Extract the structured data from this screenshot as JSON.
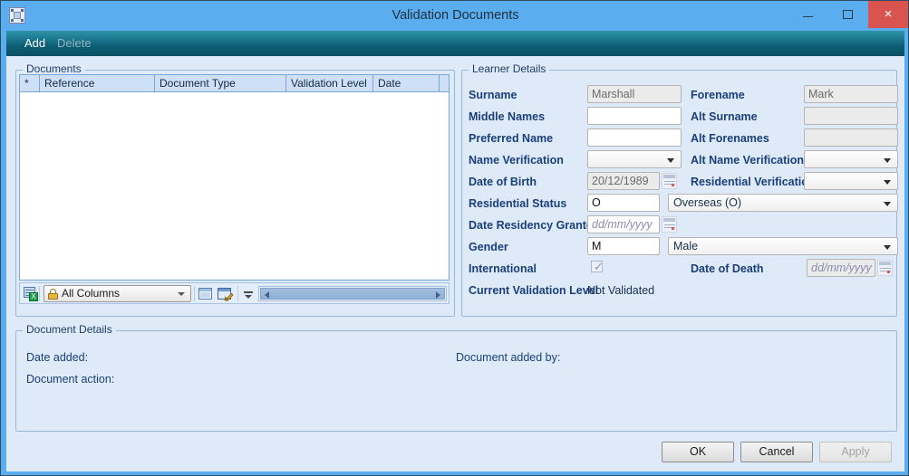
{
  "window": {
    "title": "Validation Documents",
    "app_icon": "grid-app-icon",
    "minimize": "minimize-icon",
    "maximize": "maximize-icon",
    "close_glyph": "×"
  },
  "actionbar": {
    "add": "Add",
    "delete": "Delete"
  },
  "documents": {
    "legend": "Documents",
    "columns": [
      {
        "label": "*"
      },
      {
        "label": "Reference"
      },
      {
        "label": "Document Type"
      },
      {
        "label": "Validation Level"
      },
      {
        "label": "Date"
      },
      {
        "label": ""
      }
    ],
    "rows": [],
    "toolbar": {
      "export_icon": "export-to-excel-icon",
      "export_mark": "X",
      "column_filter": {
        "lock_icon": "lock-icon",
        "value": "All Columns"
      },
      "layout_icon": "grid-layout-icon",
      "edit_layout_icon": "edit-grid-layout-icon",
      "splitter_icon": "splitter-handle-icon",
      "scroll_left_icon": "scroll-left-arrow-icon",
      "scroll_right_icon": "scroll-right-arrow-icon"
    }
  },
  "learner": {
    "legend": "Learner Details",
    "left": {
      "surname_label": "Surname",
      "surname_value": "Marshall",
      "middle_names_label": "Middle Names",
      "middle_names_value": "",
      "preferred_name_label": "Preferred Name",
      "preferred_name_value": "",
      "name_verification_label": "Name Verification",
      "name_verification_value": "",
      "dob_label": "Date of Birth",
      "dob_value": "20/12/1989",
      "residential_status_label": "Residential Status",
      "residential_status_code": "O",
      "residential_status_value": "Overseas (O)",
      "date_residency_label": "Date Residency Granted",
      "date_residency_placeholder": "dd/mm/yyyy",
      "gender_label": "Gender",
      "gender_code": "M",
      "gender_value": "Male",
      "international_label": "International",
      "international_checked": "✓",
      "current_validation_label": "Current Validation Level",
      "current_validation_value": "Not Validated"
    },
    "right": {
      "forename_label": "Forename",
      "forename_value": "Mark",
      "alt_surname_label": "Alt Surname",
      "alt_surname_value": "",
      "alt_forenames_label": "Alt Forenames",
      "alt_forenames_value": "",
      "alt_name_verification_label": "Alt Name Verification",
      "alt_name_verification_value": "",
      "residential_verification_label": "Residential Verification",
      "residential_verification_value": "",
      "date_of_death_label": "Date of Death",
      "date_of_death_placeholder": "dd/mm/yyyy"
    }
  },
  "document_details": {
    "legend": "Document Details",
    "date_added_label": "Date added:",
    "document_added_by_label": "Document added by:",
    "document_action_label": "Document action:"
  },
  "footer": {
    "ok": "OK",
    "cancel": "Cancel",
    "apply": "Apply"
  }
}
